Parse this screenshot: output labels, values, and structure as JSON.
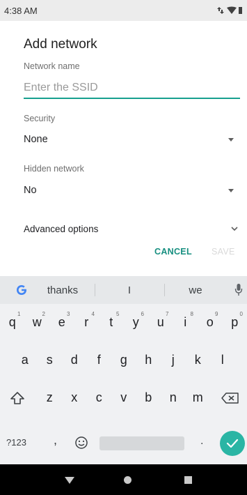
{
  "status_bar": {
    "time": "4:38 AM"
  },
  "dialog": {
    "title": "Add network",
    "network_name_label": "Network name",
    "ssid_placeholder": "Enter the SSID",
    "ssid_value": "",
    "security_label": "Security",
    "security_value": "None",
    "hidden_label": "Hidden network",
    "hidden_value": "No",
    "advanced_label": "Advanced options",
    "cancel_label": "CANCEL",
    "save_label": "SAVE"
  },
  "keyboard": {
    "suggestions": [
      "thanks",
      "I",
      "we"
    ],
    "row1": [
      {
        "key": "q",
        "hint": "1"
      },
      {
        "key": "w",
        "hint": "2"
      },
      {
        "key": "e",
        "hint": "3"
      },
      {
        "key": "r",
        "hint": "4"
      },
      {
        "key": "t",
        "hint": "5"
      },
      {
        "key": "y",
        "hint": "6"
      },
      {
        "key": "u",
        "hint": "7"
      },
      {
        "key": "i",
        "hint": "8"
      },
      {
        "key": "o",
        "hint": "9"
      },
      {
        "key": "p",
        "hint": "0"
      }
    ],
    "row2": [
      "a",
      "s",
      "d",
      "f",
      "g",
      "h",
      "j",
      "k",
      "l"
    ],
    "row3": [
      "z",
      "x",
      "c",
      "v",
      "b",
      "n",
      "m"
    ],
    "symbols_label": "?123",
    "comma_label": ",",
    "period_label": "."
  },
  "colors": {
    "accent": "#17a08f",
    "enter": "#2ab5a4"
  }
}
